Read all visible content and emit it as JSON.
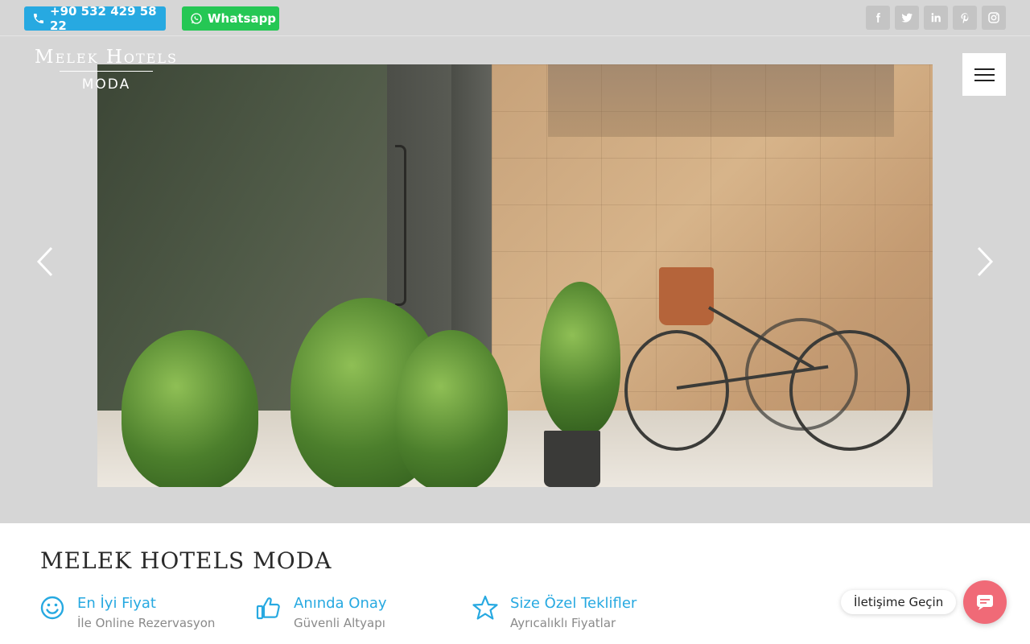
{
  "topbar": {
    "phone_label": "+90 532 429 58 22",
    "whatsapp_label": "Whatsapp",
    "social_icons": [
      "facebook-icon",
      "twitter-icon",
      "linkedin-icon",
      "pinterest-icon",
      "instagram-icon"
    ]
  },
  "logo": {
    "line1": "Melek Hotels",
    "line2": "MODA"
  },
  "page": {
    "title": "MELEK HOTELS MODA"
  },
  "features": [
    {
      "icon": "smiley-icon",
      "title": "En İyi Fiyat",
      "subtitle": "İle Online Rezervasyon"
    },
    {
      "icon": "thumbs-up-icon",
      "title": "Anında Onay",
      "subtitle": "Güvenli Altyapı"
    },
    {
      "icon": "star-icon",
      "title": "Size Özel Teklifler",
      "subtitle": "Ayrıcalıklı Fiyatlar"
    }
  ],
  "contact": {
    "label": "İletişime Geçin"
  },
  "colors": {
    "accent": "#27a9e1",
    "whatsapp": "#25c754",
    "contact": "#f06a77"
  }
}
